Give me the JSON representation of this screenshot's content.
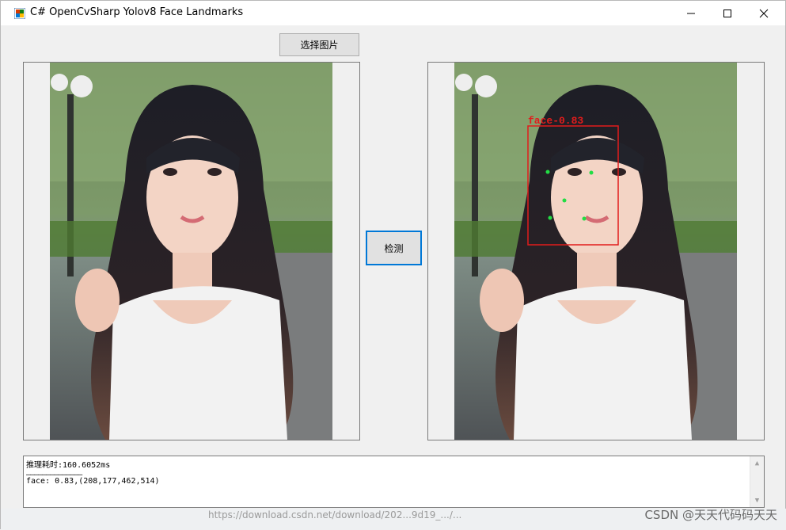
{
  "window": {
    "title": "C# OpenCvSharp Yolov8 Face Landmarks"
  },
  "controls": {
    "select_image_label": "选择图片",
    "detect_label": "检测"
  },
  "result": {
    "detection_label": "face-0.83",
    "log_line1": "推理耗时:160.6052ms",
    "log_separator": "——————————————",
    "log_line2": "face: 0.83,(208,177,462,514)"
  },
  "footer": {
    "url": "https://download.csdn.net/download/202...9d19_.../...",
    "watermark": "CSDN @天天代码码天天"
  },
  "colors": {
    "accent": "#0078d7",
    "box": "#e21c1c",
    "landmark": "#22dd44"
  }
}
